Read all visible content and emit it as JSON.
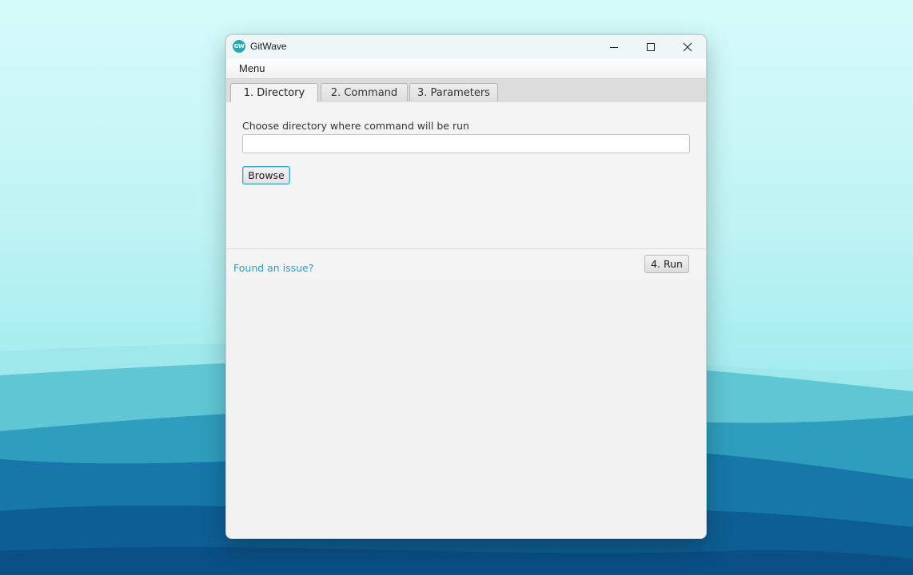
{
  "window": {
    "title": "GitWave",
    "app_icon_text": "GW",
    "controls": [
      "minimize-icon",
      "maximize-icon",
      "close-icon"
    ]
  },
  "menubar": {
    "items": [
      {
        "label": "Menu"
      }
    ]
  },
  "tabs": [
    {
      "label": "1. Directory",
      "active": true
    },
    {
      "label": "2. Command",
      "active": false
    },
    {
      "label": "3. Parameters",
      "active": false
    }
  ],
  "directory": {
    "label": "Choose directory where command will be run",
    "value": "",
    "browse_label": "Browse"
  },
  "footer": {
    "issue_link": "Found an issue?",
    "run_label": "4. Run"
  },
  "colors": {
    "accent": "#2a9fbd",
    "focus_border": "#3aa6c7",
    "app_icon": "#2ba7b3"
  }
}
